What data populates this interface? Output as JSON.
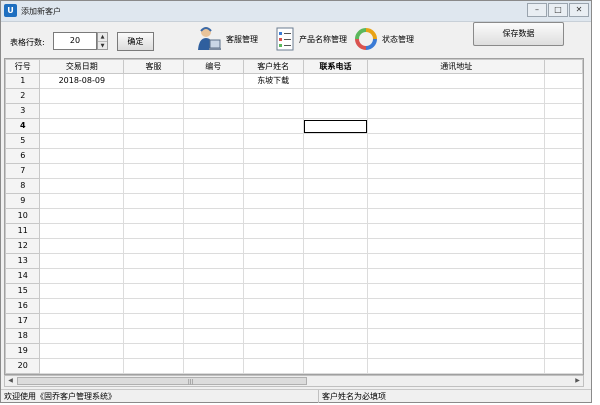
{
  "window": {
    "title": "添加新客户",
    "app_icon": "app-logo-icon",
    "controls": [
      "minimize-icon",
      "maximize-icon",
      "close-icon"
    ]
  },
  "toolbar": {
    "rows_label": "表格行数:",
    "rows_value": "20",
    "confirm_label": "确定",
    "tools": [
      {
        "label": "客服管理",
        "icon": "customer-service-icon"
      },
      {
        "label": "产品名称管理",
        "icon": "product-list-icon"
      },
      {
        "label": "状态管理",
        "icon": "status-cycle-icon"
      }
    ],
    "save_label": "保存数据"
  },
  "grid": {
    "columns": [
      "行号",
      "交易日期",
      "客服",
      "编号",
      "客户姓名",
      "联系电话",
      "通讯地址",
      ""
    ],
    "bold_column": "联系电话",
    "rows": [
      [
        "1",
        "2018-08-09",
        "",
        "",
        "东坡下载",
        "",
        "",
        ""
      ],
      [
        "2",
        "",
        "",
        "",
        "",
        "",
        "",
        ""
      ],
      [
        "3",
        "",
        "",
        "",
        "",
        "",
        "",
        ""
      ],
      [
        "4",
        "",
        "",
        "",
        "",
        "",
        "",
        ""
      ],
      [
        "5",
        "",
        "",
        "",
        "",
        "",
        "",
        ""
      ],
      [
        "6",
        "",
        "",
        "",
        "",
        "",
        "",
        ""
      ],
      [
        "7",
        "",
        "",
        "",
        "",
        "",
        "",
        ""
      ],
      [
        "8",
        "",
        "",
        "",
        "",
        "",
        "",
        ""
      ],
      [
        "9",
        "",
        "",
        "",
        "",
        "",
        "",
        ""
      ],
      [
        "10",
        "",
        "",
        "",
        "",
        "",
        "",
        ""
      ],
      [
        "11",
        "",
        "",
        "",
        "",
        "",
        "",
        ""
      ],
      [
        "12",
        "",
        "",
        "",
        "",
        "",
        "",
        ""
      ],
      [
        "13",
        "",
        "",
        "",
        "",
        "",
        "",
        ""
      ],
      [
        "14",
        "",
        "",
        "",
        "",
        "",
        "",
        ""
      ],
      [
        "15",
        "",
        "",
        "",
        "",
        "",
        "",
        ""
      ],
      [
        "16",
        "",
        "",
        "",
        "",
        "",
        "",
        ""
      ],
      [
        "17",
        "",
        "",
        "",
        "",
        "",
        "",
        ""
      ],
      [
        "18",
        "",
        "",
        "",
        "",
        "",
        "",
        ""
      ],
      [
        "19",
        "",
        "",
        "",
        "",
        "",
        "",
        ""
      ],
      [
        "20",
        "",
        "",
        "",
        "",
        "",
        "",
        ""
      ]
    ],
    "current_row": 4,
    "selected_cell": {
      "row": 4,
      "col": 5
    }
  },
  "status": {
    "left": "欢迎使用《固乔客户管理系统》",
    "right": "客户姓名为必填项"
  }
}
